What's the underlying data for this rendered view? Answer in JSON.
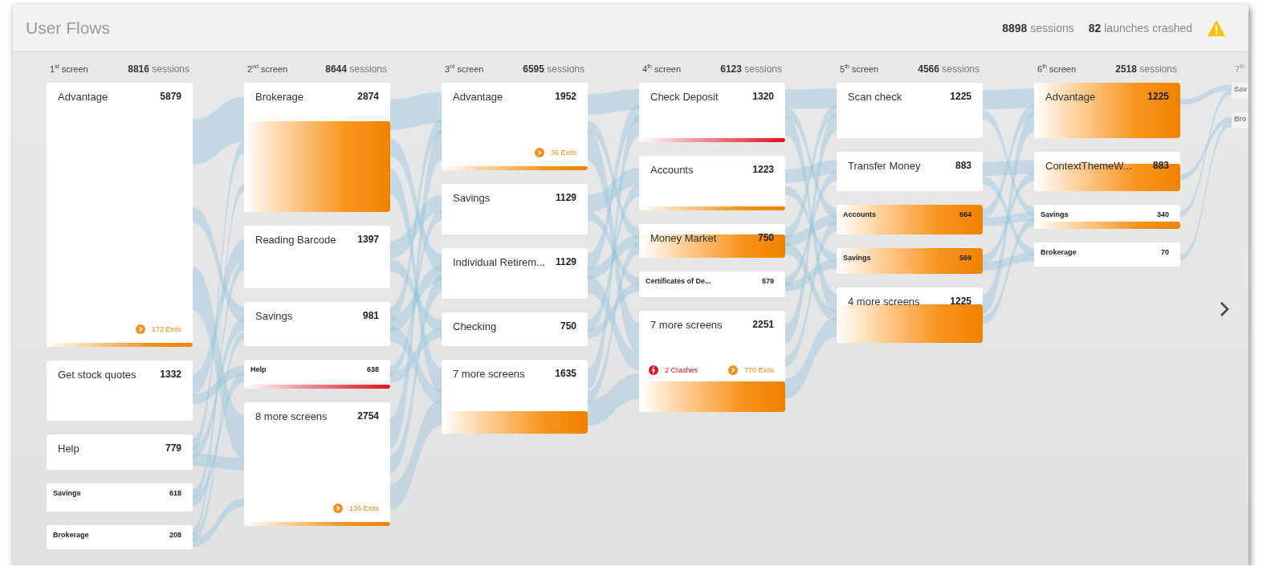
{
  "header": {
    "title": "User Flows",
    "sessions": "**8898** sessions",
    "crashed": "**82** launches crashed"
  },
  "columns": [
    {
      "ordinal": "1$^{st}$ screen",
      "sessions": "**8816** sessions",
      "dimmed": false,
      "nodes": [
        {
          "name": "Advantage",
          "count": "5879",
          "kind": "exitline",
          "exits": "172 Exits"
        },
        {
          "name": "Get stock quotes",
          "count": "1332",
          "kind": "plain"
        },
        {
          "name": "Help",
          "count": "779",
          "kind": "plain"
        },
        {
          "name": "Savings",
          "count": "618",
          "kind": "plain"
        },
        {
          "name": "Brokerage",
          "count": "208",
          "kind": "plain"
        }
      ]
    },
    {
      "ordinal": "2$^{nd}$ screen",
      "sessions": "**8644** sessions",
      "dimmed": false,
      "nodes": [
        {
          "name": "Brokerage",
          "count": "2874",
          "kind": "exithigh"
        },
        {
          "name": "Reading Barcode",
          "count": "1397",
          "kind": "plain"
        },
        {
          "name": "Savings",
          "count": "981",
          "kind": "plain"
        },
        {
          "name": "Help",
          "count": "638",
          "kind": "crashline"
        },
        {
          "name": "8 more screens",
          "count": "2754",
          "kind": "exitline",
          "exits": "136 Exits"
        }
      ]
    },
    {
      "ordinal": "3$^{rd}$ screen",
      "sessions": "**6595** sessions",
      "dimmed": false,
      "nodes": [
        {
          "name": "Advantage",
          "count": "1952",
          "kind": "exitline",
          "exits": "36 Exits"
        },
        {
          "name": "Savings",
          "count": "1129",
          "kind": "plain"
        },
        {
          "name": "Individual Retirem...",
          "count": "1129",
          "kind": "plain"
        },
        {
          "name": "Checking",
          "count": "750",
          "kind": "plain"
        },
        {
          "name": "7 more screens",
          "count": "1635",
          "kind": "exitlow"
        }
      ]
    },
    {
      "ordinal": "4$^{th}$ screen",
      "sessions": "**6123** sessions",
      "dimmed": false,
      "nodes": [
        {
          "name": "Check Deposit",
          "count": "1320",
          "kind": "crashline"
        },
        {
          "name": "Accounts",
          "count": "1223",
          "kind": "exitline"
        },
        {
          "name": "Money Market",
          "count": "750",
          "kind": "exithigh"
        },
        {
          "name": "Certificates of De...",
          "count": "579",
          "kind": "plain"
        },
        {
          "name": "7 more screens",
          "count": "2251",
          "kind": "exitlow",
          "crashes": "2 Crashes",
          "exits": "770 Exits"
        }
      ]
    },
    {
      "ordinal": "5$^{th}$ screen",
      "sessions": "**4566** sessions",
      "dimmed": false,
      "nodes": [
        {
          "name": "Scan check",
          "count": "1225",
          "kind": "plain"
        },
        {
          "name": "Transfer Money",
          "count": "883",
          "kind": "plain"
        },
        {
          "name": "Accounts",
          "count": "664",
          "kind": "exitfull"
        },
        {
          "name": "Savings",
          "count": "569",
          "kind": "exitfull"
        },
        {
          "name": "4 more screens",
          "count": "1225",
          "kind": "exithigh"
        }
      ]
    },
    {
      "ordinal": "6$^{th}$ screen",
      "sessions": "**2518** sessions",
      "dimmed": false,
      "nodes": [
        {
          "name": "Advantage",
          "count": "1225",
          "kind": "exitfull"
        },
        {
          "name": "ContextThemeW...",
          "count": "883",
          "kind": "exithigh"
        },
        {
          "name": "Savings",
          "count": "340",
          "kind": "exitlow"
        },
        {
          "name": "Brokerage",
          "count": "70",
          "kind": "plain"
        }
      ]
    },
    {
      "ordinal": "7$^{th}$",
      "dimmed": true,
      "nodes": [
        {
          "name": "Sav",
          "kind": "plain"
        },
        {
          "name": "Bro",
          "kind": "plain"
        }
      ]
    }
  ]
}
